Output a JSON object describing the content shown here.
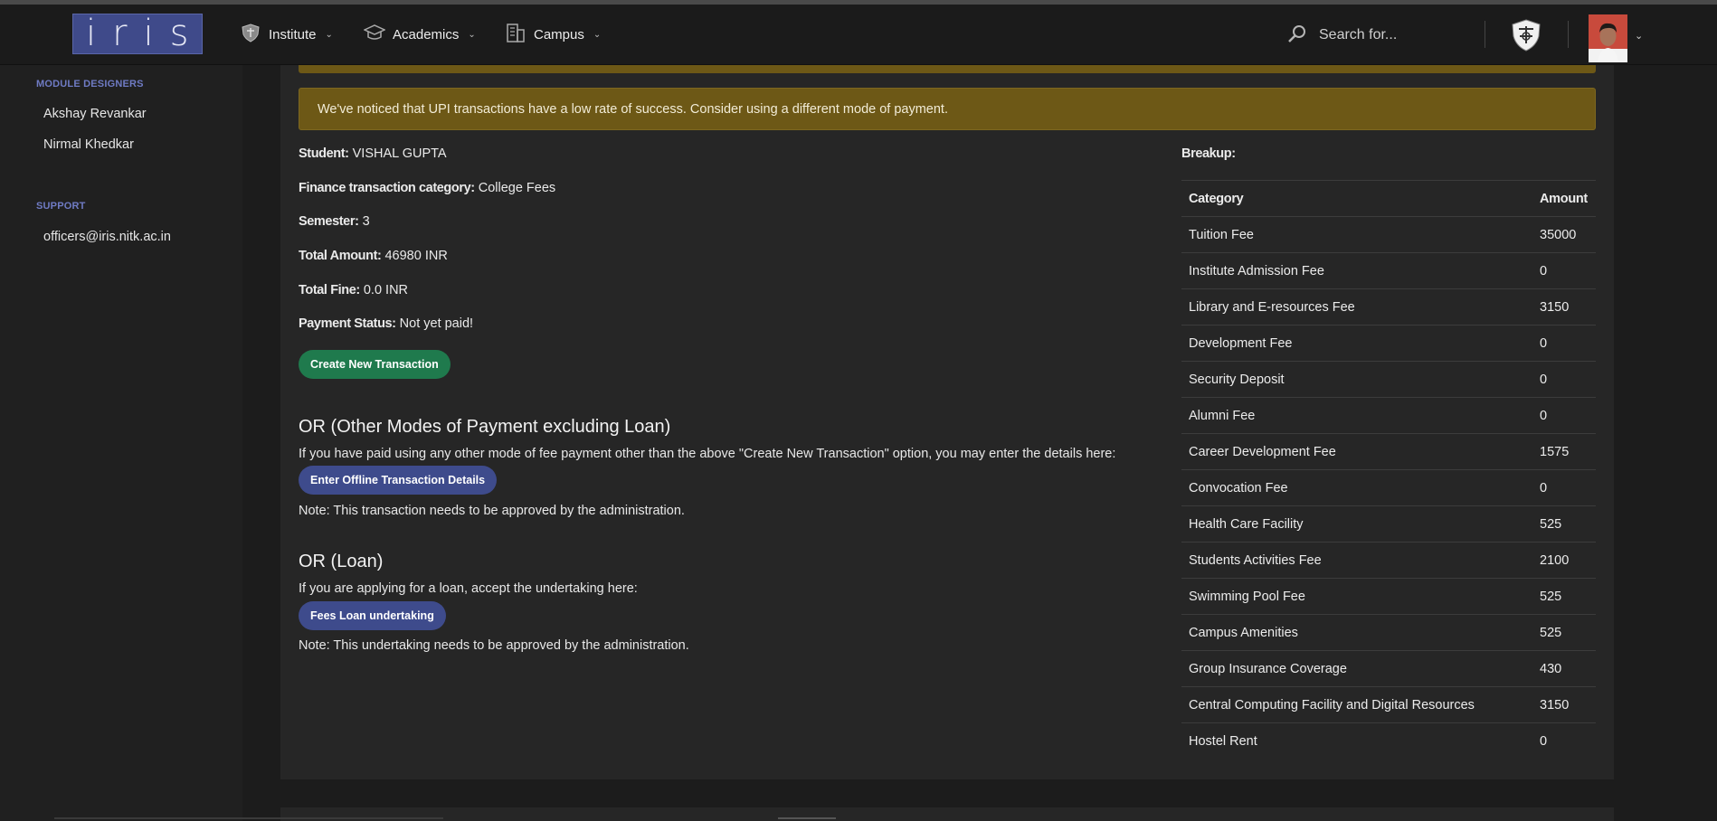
{
  "navbar": {
    "logo": "iris",
    "items": [
      {
        "label": "Institute",
        "icon": "shield-icon"
      },
      {
        "label": "Academics",
        "icon": "graduation-cap-icon"
      },
      {
        "label": "Campus",
        "icon": "building-icon"
      }
    ],
    "search_placeholder": "Search for..."
  },
  "sidebar": {
    "designers_heading": "MODULE DESIGNERS",
    "designers": [
      "Akshay Revankar",
      "Nirmal Khedkar"
    ],
    "support_heading": "SUPPORT",
    "support_email": "officers@iris.nitk.ac.in"
  },
  "alert": "We've noticed that UPI transactions have a low rate of success. Consider using a different mode of payment.",
  "details": {
    "student_label": "Student:",
    "student_value": "VISHAL GUPTA",
    "category_label": "Finance transaction category:",
    "category_value": "College Fees",
    "semester_label": "Semester:",
    "semester_value": "3",
    "total_label": "Total Amount:",
    "total_value": "46980 INR",
    "fine_label": "Total Fine:",
    "fine_value": "0.0 INR",
    "status_label": "Payment Status:",
    "status_value": "Not yet paid!"
  },
  "create_button": "Create New Transaction",
  "other_modes": {
    "heading": "OR (Other Modes of Payment excluding Loan)",
    "description": "If you have paid using any other mode of fee payment other than the above \"Create New Transaction\" option, you may enter the details here:",
    "button": "Enter Offline Transaction Details",
    "note": "Note: This transaction needs to be approved by the administration."
  },
  "loan": {
    "heading": "OR (Loan)",
    "description": "If you are applying for a loan, accept the undertaking here:",
    "button": "Fees Loan undertaking",
    "note": "Note: This undertaking needs to be approved by the administration."
  },
  "breakup": {
    "label": "Breakup:",
    "headers": {
      "category": "Category",
      "amount": "Amount"
    },
    "rows": [
      {
        "category": "Tuition Fee",
        "amount": "35000"
      },
      {
        "category": "Institute Admission Fee",
        "amount": "0"
      },
      {
        "category": "Library and E-resources Fee",
        "amount": "3150"
      },
      {
        "category": "Development Fee",
        "amount": "0"
      },
      {
        "category": "Security Deposit",
        "amount": "0"
      },
      {
        "category": "Alumni Fee",
        "amount": "0"
      },
      {
        "category": "Career Development Fee",
        "amount": "1575"
      },
      {
        "category": "Convocation Fee",
        "amount": "0"
      },
      {
        "category": "Health Care Facility",
        "amount": "525"
      },
      {
        "category": "Students Activities Fee",
        "amount": "2100"
      },
      {
        "category": "Swimming Pool Fee",
        "amount": "525"
      },
      {
        "category": "Campus Amenities",
        "amount": "525"
      },
      {
        "category": "Group Insurance Coverage",
        "amount": "430"
      },
      {
        "category": "Central Computing Facility and Digital Resources",
        "amount": "3150"
      },
      {
        "category": "Hostel Rent",
        "amount": "0"
      }
    ]
  },
  "colors": {
    "accent": "#3e4b8c",
    "success": "#1f7a4d",
    "warning_bg": "#6d5816",
    "sidebar_heading": "#6f7bc4"
  }
}
